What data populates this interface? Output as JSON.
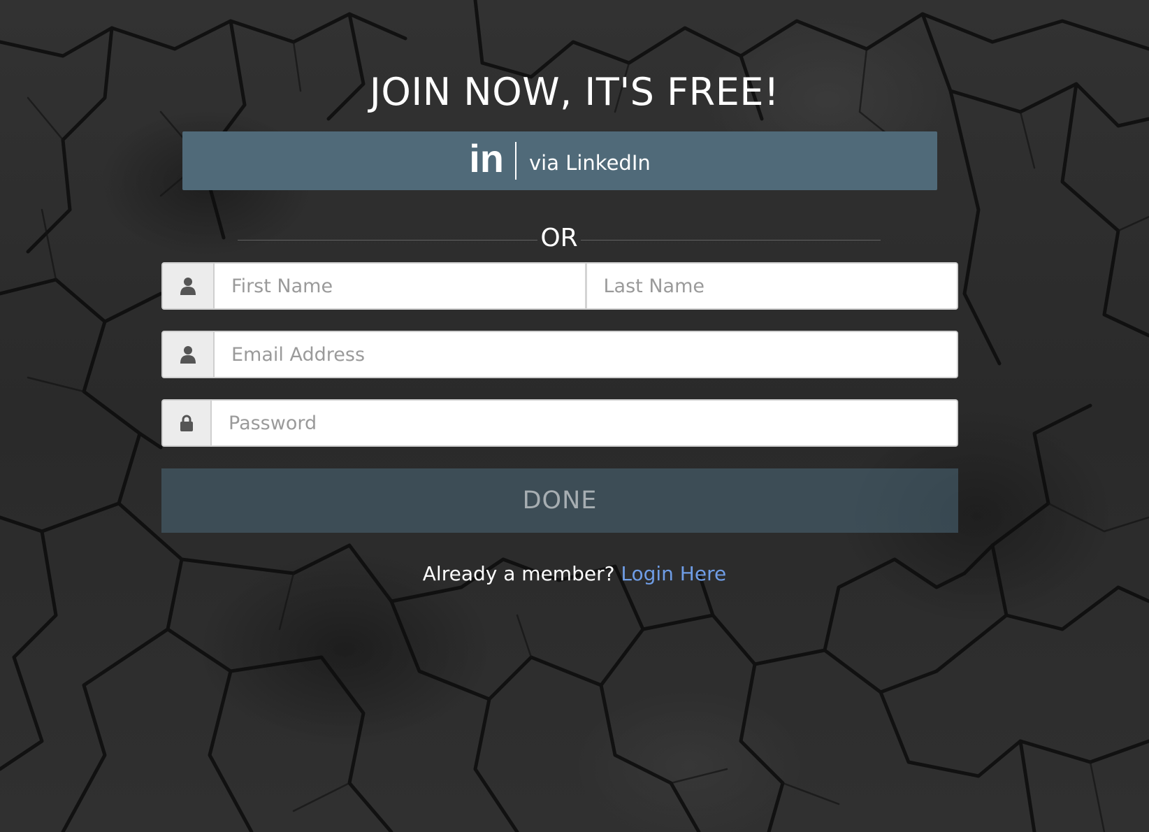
{
  "heading": "JOIN NOW, IT'S FREE!",
  "linkedin": {
    "logo_text": "in",
    "label": "via LinkedIn",
    "icon": "linkedin-icon"
  },
  "divider_text": "OR",
  "form": {
    "first_name": {
      "placeholder": "First Name",
      "value": "",
      "icon": "user-icon"
    },
    "last_name": {
      "placeholder": "Last Name",
      "value": ""
    },
    "email": {
      "placeholder": "Email Address",
      "value": "",
      "icon": "user-icon"
    },
    "password": {
      "placeholder": "Password",
      "value": "",
      "icon": "lock-icon"
    },
    "submit_label": "DONE"
  },
  "footer": {
    "prompt": "Already a member?",
    "link_label": "Login Here"
  },
  "colors": {
    "linkedin_bg": "#506a79",
    "done_bg": "#4c6a7a",
    "link": "#6f9de6"
  }
}
